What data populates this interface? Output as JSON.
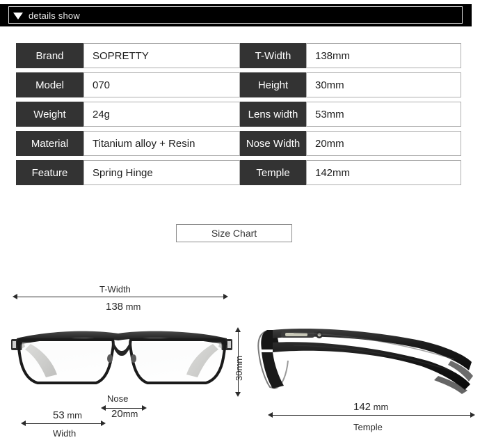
{
  "header": {
    "title": "details show",
    "caret_icon": "triangle-down-icon",
    "background": "#000000",
    "text_color": "#e8e8e8"
  },
  "spec_table": {
    "label_bg": "#333333",
    "label_color": "#ffffff",
    "value_border": "#adadad",
    "rows": [
      {
        "label_left": "Brand",
        "value_left": "SOPRETTY",
        "label_right": "T-Width",
        "value_right": "138mm"
      },
      {
        "label_left": "Model",
        "value_left": "070",
        "label_right": "Height",
        "value_right": "30mm"
      },
      {
        "label_left": "Weight",
        "value_left": "24g",
        "label_right": "Lens width",
        "value_right": "53mm"
      },
      {
        "label_left": "Material",
        "value_left": "Titanium alloy + Resin",
        "label_right": "Nose Width",
        "value_right": "20mm"
      },
      {
        "label_left": "Feature",
        "value_left": "Spring Hinge",
        "label_right": "Temple",
        "value_right": "142mm"
      }
    ]
  },
  "size_chart": {
    "title": "Size Chart",
    "front_view": {
      "total_width": {
        "label": "T-Width",
        "value": "138",
        "unit": "mm"
      },
      "lens_width": {
        "label": "Width",
        "value": "53",
        "unit": "mm"
      },
      "nose_width": {
        "label": "Nose",
        "value": "20",
        "unit": "mm"
      },
      "image_alt": "eyeglasses-front-view"
    },
    "side_view": {
      "lens_height": {
        "label": "",
        "value": "30mm",
        "unit": ""
      },
      "temple": {
        "label": "Temple",
        "value": "142",
        "unit": "mm"
      },
      "image_alt": "eyeglasses-side-view"
    }
  }
}
